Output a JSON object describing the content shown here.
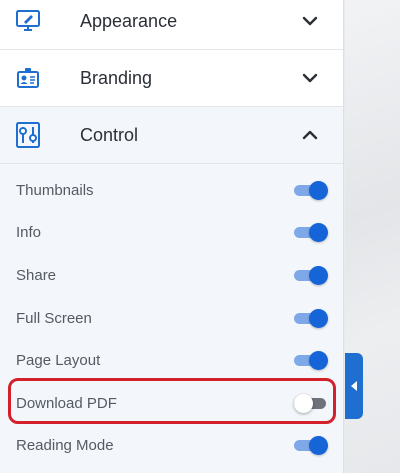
{
  "colors": {
    "accent": "#1565d8",
    "accent_track": "#7fa8e8",
    "highlight": "#d3202a",
    "icon_blue": "#1f6fd0"
  },
  "sections": [
    {
      "label": "Appearance",
      "icon": "monitor-brush-icon",
      "expanded": false
    },
    {
      "label": "Branding",
      "icon": "id-badge-icon",
      "expanded": false
    },
    {
      "label": "Control",
      "icon": "sliders-icon",
      "expanded": true
    }
  ],
  "control": {
    "options": [
      {
        "label": "Thumbnails",
        "enabled": true
      },
      {
        "label": "Info",
        "enabled": true
      },
      {
        "label": "Share",
        "enabled": true
      },
      {
        "label": "Full Screen",
        "enabled": true
      },
      {
        "label": "Page Layout",
        "enabled": true
      },
      {
        "label": "Download PDF",
        "enabled": false
      },
      {
        "label": "Reading Mode",
        "enabled": true
      }
    ]
  },
  "collapse_tab_icon": "caret-left-icon"
}
